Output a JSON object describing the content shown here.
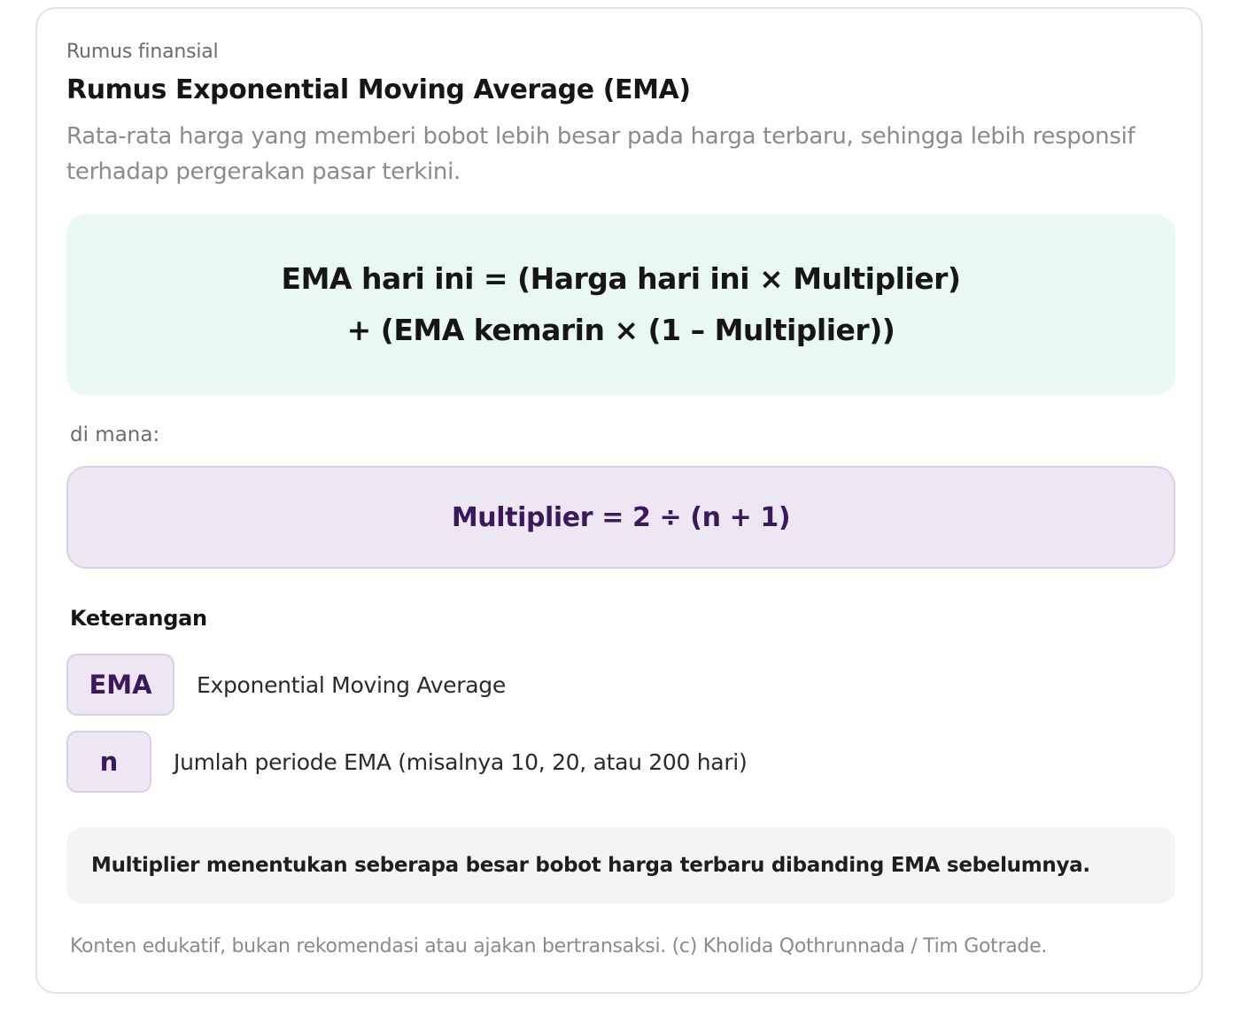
{
  "header": {
    "eyebrow": "Rumus finansial",
    "title": "Rumus Exponential Moving Average (EMA)",
    "subtitle": "Rata-rata harga yang memberi bobot lebih besar pada harga terbaru, sehingga lebih responsif terhadap pergerakan pasar terkini."
  },
  "formula": {
    "main_line_1": "EMA hari ini = (Harga hari ini × Multiplier)",
    "main_line_2": "+ (EMA kemarin × (1 – Multiplier))",
    "where_label": "di mana:",
    "sub": "Multiplier = 2 ÷ (n + 1)"
  },
  "legend": {
    "heading": "Keterangan",
    "items": [
      {
        "symbol": "EMA",
        "description": "Exponential Moving Average"
      },
      {
        "symbol": "n",
        "description": "Jumlah periode EMA (misalnya 10, 20, atau 200 hari)"
      }
    ]
  },
  "note": "Multiplier menentukan seberapa besar bobot harga terbaru dibanding EMA sebelumnya.",
  "footer": "Konten edukatif, bukan rekomendasi atau ajakan bertransaksi. (c) Kholida Qothrunnada / Tim Gotrade.",
  "colors": {
    "formula_main_bg": "#e9f9f2",
    "formula_sub_bg": "#ede7f4",
    "accent_purple": "#3b1a5c",
    "note_bg": "#f4f4f7"
  }
}
